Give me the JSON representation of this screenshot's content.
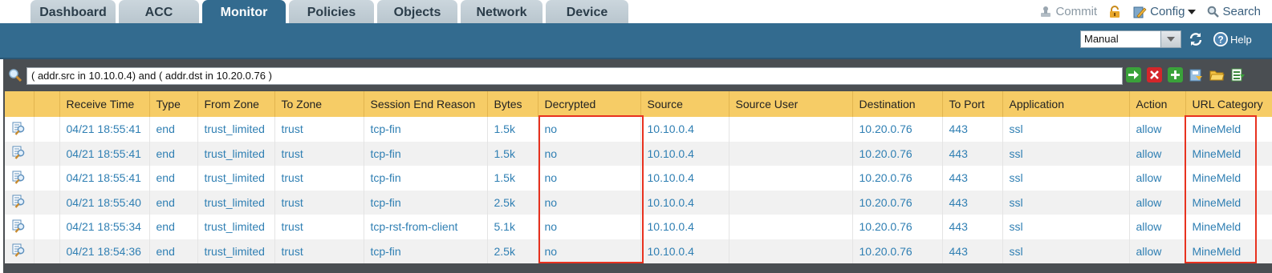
{
  "nav": {
    "tabs": [
      {
        "label": "Dashboard",
        "active": false
      },
      {
        "label": "ACC",
        "active": false
      },
      {
        "label": "Monitor",
        "active": true
      },
      {
        "label": "Policies",
        "active": false
      },
      {
        "label": "Objects",
        "active": false
      },
      {
        "label": "Network",
        "active": false
      },
      {
        "label": "Device",
        "active": false
      }
    ],
    "commit_label": "Commit",
    "config_label": "Config",
    "search_label": "Search"
  },
  "toolbar": {
    "refresh_mode": "Manual",
    "help_label": "Help"
  },
  "filter": {
    "query": "( addr.src in 10.10.0.4) and ( addr.dst in 10.20.0.76 )"
  },
  "table": {
    "columns": [
      "",
      "",
      "Receive Time",
      "Type",
      "From Zone",
      "To Zone",
      "Session End Reason",
      "Bytes",
      "Decrypted",
      "Source",
      "Source User",
      "Destination",
      "To Port",
      "Application",
      "Action",
      "URL Category"
    ],
    "rows": [
      {
        "receive_time": "04/21 18:55:41",
        "type": "end",
        "from_zone": "trust_limited",
        "to_zone": "trust",
        "end_reason": "tcp-fin",
        "bytes": "1.5k",
        "decrypted": "no",
        "source": "10.10.0.4",
        "source_user": "",
        "destination": "10.20.0.76",
        "to_port": "443",
        "application": "ssl",
        "action": "allow",
        "url_category": "MineMeld"
      },
      {
        "receive_time": "04/21 18:55:41",
        "type": "end",
        "from_zone": "trust_limited",
        "to_zone": "trust",
        "end_reason": "tcp-fin",
        "bytes": "1.5k",
        "decrypted": "no",
        "source": "10.10.0.4",
        "source_user": "",
        "destination": "10.20.0.76",
        "to_port": "443",
        "application": "ssl",
        "action": "allow",
        "url_category": "MineMeld"
      },
      {
        "receive_time": "04/21 18:55:41",
        "type": "end",
        "from_zone": "trust_limited",
        "to_zone": "trust",
        "end_reason": "tcp-fin",
        "bytes": "1.5k",
        "decrypted": "no",
        "source": "10.10.0.4",
        "source_user": "",
        "destination": "10.20.0.76",
        "to_port": "443",
        "application": "ssl",
        "action": "allow",
        "url_category": "MineMeld"
      },
      {
        "receive_time": "04/21 18:55:40",
        "type": "end",
        "from_zone": "trust_limited",
        "to_zone": "trust",
        "end_reason": "tcp-fin",
        "bytes": "2.5k",
        "decrypted": "no",
        "source": "10.10.0.4",
        "source_user": "",
        "destination": "10.20.0.76",
        "to_port": "443",
        "application": "ssl",
        "action": "allow",
        "url_category": "MineMeld"
      },
      {
        "receive_time": "04/21 18:55:34",
        "type": "end",
        "from_zone": "trust_limited",
        "to_zone": "trust",
        "end_reason": "tcp-rst-from-client",
        "bytes": "5.1k",
        "decrypted": "no",
        "source": "10.10.0.4",
        "source_user": "",
        "destination": "10.20.0.76",
        "to_port": "443",
        "application": "ssl",
        "action": "allow",
        "url_category": "MineMeld"
      },
      {
        "receive_time": "04/21 18:54:36",
        "type": "end",
        "from_zone": "trust_limited",
        "to_zone": "trust",
        "end_reason": "tcp-fin",
        "bytes": "2.5k",
        "decrypted": "no",
        "source": "10.10.0.4",
        "source_user": "",
        "destination": "10.20.0.76",
        "to_port": "443",
        "application": "ssl",
        "action": "allow",
        "url_category": "MineMeld"
      }
    ]
  },
  "colors": {
    "nav_blue": "#336b8f",
    "header_yellow": "#f6cc66",
    "link_blue": "#2f7fb3",
    "highlight_red": "#e8321f"
  },
  "icons": {
    "row_detail": "magnifier-log-detail-icon",
    "filter_search": "magnifier-icon",
    "filter_apply": "arrow-right-icon",
    "filter_clear": "x-icon",
    "filter_add": "plus-icon",
    "filter_save": "save-filter-icon",
    "filter_load": "folder-icon",
    "export": "export-csv-icon"
  }
}
